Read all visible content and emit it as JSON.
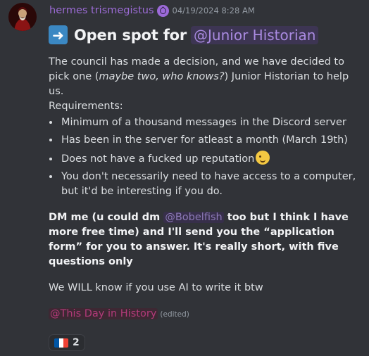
{
  "message": {
    "author": "hermes trismegistus",
    "timestamp": "04/19/2024 8:28 AM",
    "heading": {
      "emoji": "➡",
      "text": "Open spot for",
      "mention": "@Junior Historian"
    },
    "intro": "The council has made a decision, and we have decided to pick one (",
    "intro_italic": "maybe two, who knows?",
    "intro_end": ") Junior Historian to help us.",
    "requirements_label": "Requirements:",
    "requirements": [
      "Minimum of a thousand messages in the Discord server",
      "Has been in the server for atleast a month (March 19th)",
      "Does not have a fucked up reputation",
      "You don't necessarily need to have access to a computer, but it'd be interesting if you do."
    ],
    "dm_part1": "DM me (u could dm",
    "dm_mention": "@Bobelfish",
    "dm_part2": "too but I think I have more free time) and I'll send you the “application form” for you to answer. It's really short, with five questions only",
    "ai_line": "We WILL know if you use AI to write it btw",
    "footer_mention": "@This Day in History",
    "edited": "(edited)",
    "reaction": {
      "emoji": "french-flag",
      "count": "2",
      "colors": [
        "#0055a4",
        "#ffffff",
        "#ef4135"
      ]
    }
  },
  "colors": {
    "background": "#313338",
    "username": "#9b6bd4",
    "role_mention": "#b23a79"
  }
}
